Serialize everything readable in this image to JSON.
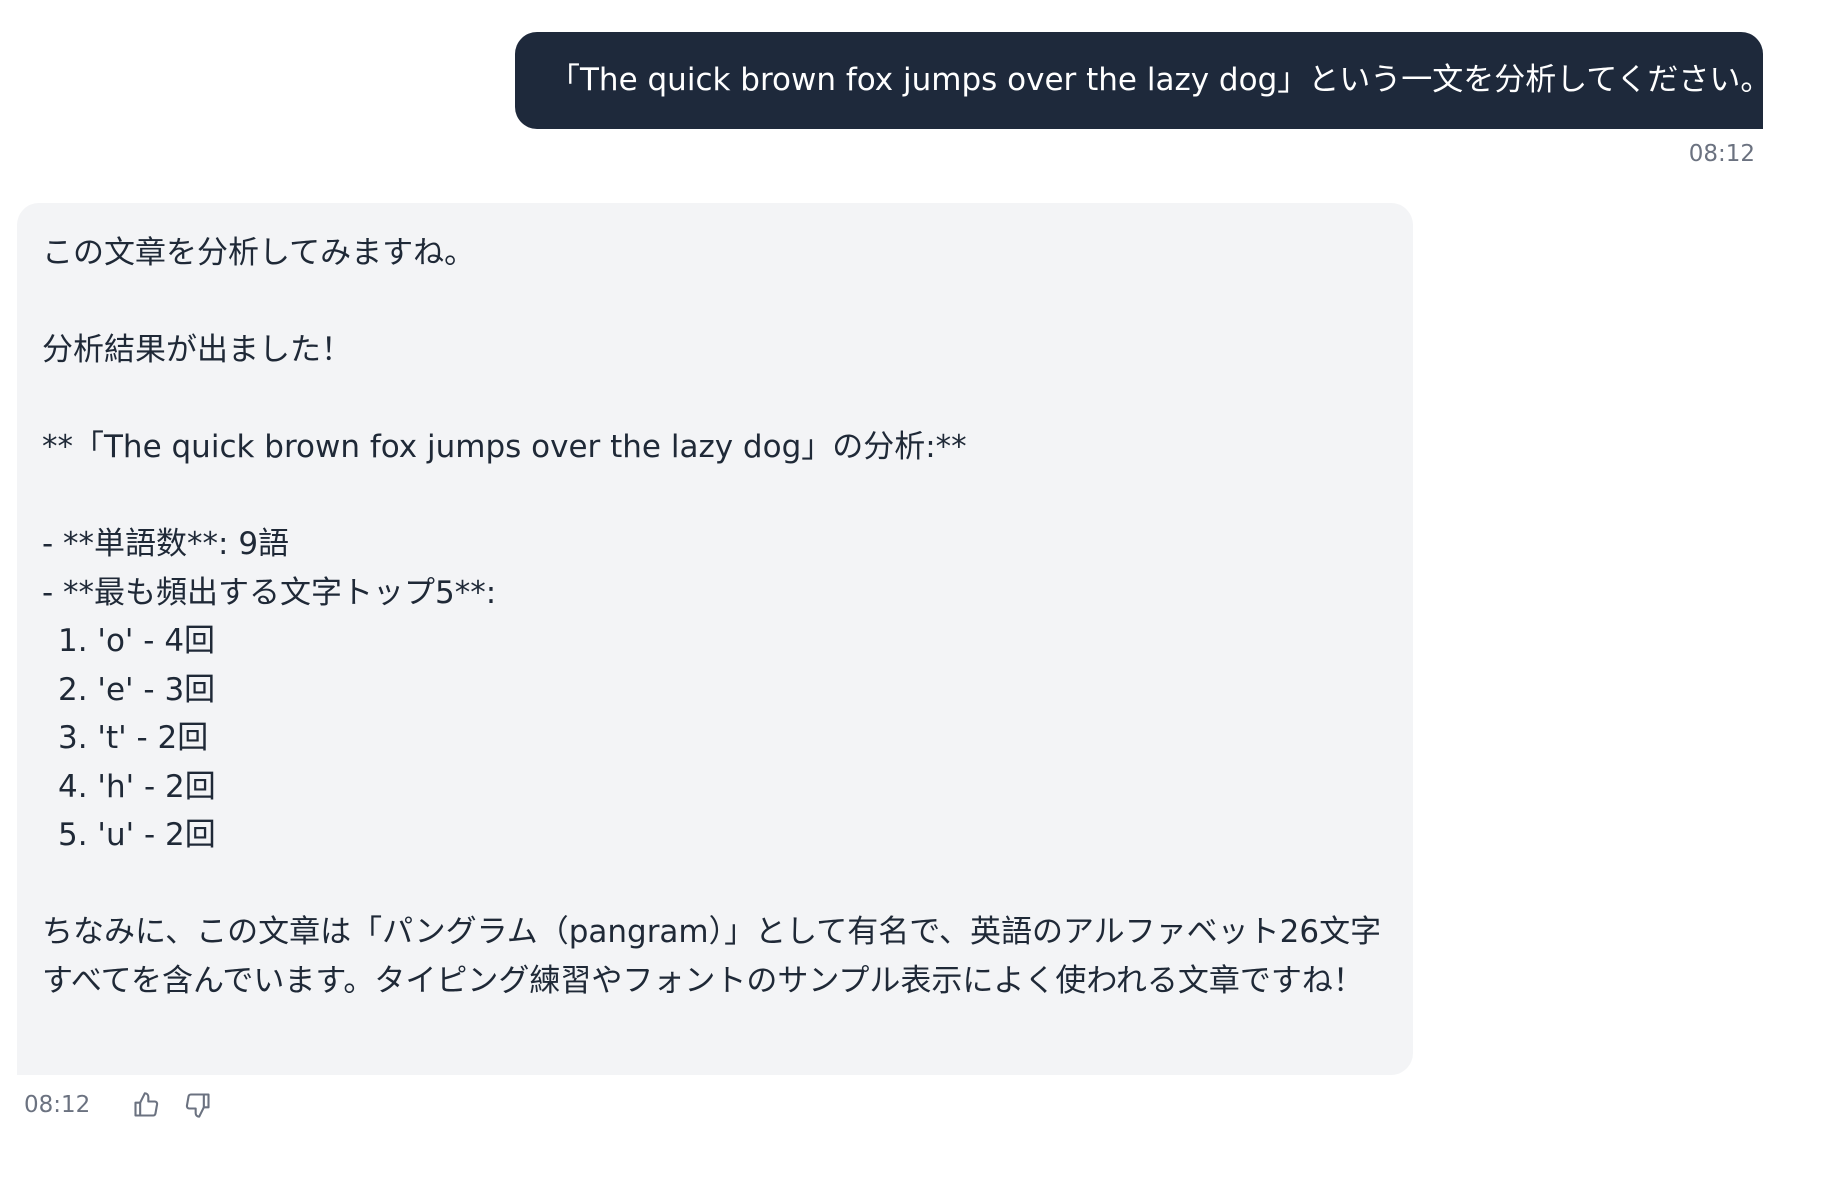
{
  "user_message": {
    "text": "「The quick brown fox jumps over the lazy dog」という一文を分析してください。",
    "time": "08:12"
  },
  "assistant_message": {
    "lines": {
      "intro": "この文章を分析してみますね。",
      "result": "分析結果が出ました！",
      "heading": "**「The quick brown fox jumps over the lazy dog」の分析:**",
      "word_count": "- **単語数**: 9語",
      "top_chars_heading": "- **最も頻出する文字トップ5**:",
      "item_1": "1. 'o' - 4回",
      "item_2": "2. 'e' - 3回",
      "item_3": "3. 't' - 2回",
      "item_4": "4. 'h' - 2回",
      "item_5": "5. 'u' - 2回",
      "closing": "ちなみに、この文章は「パングラム（pangram）」として有名で、英語のアルファベット26文字すべてを含んでいます。タイピング練習やフォントのサンプル表示によく使われる文章ですね！"
    },
    "time": "08:12",
    "feedback": {
      "thumbs_up_icon": "thumbs-up-icon",
      "thumbs_down_icon": "thumbs-down-icon"
    }
  }
}
